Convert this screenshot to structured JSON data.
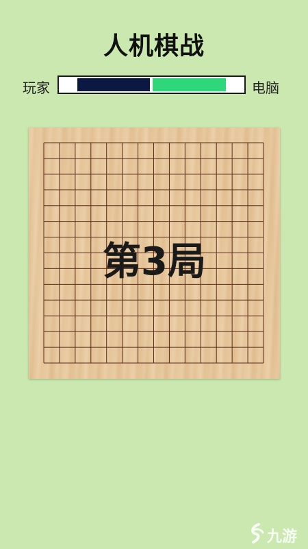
{
  "header": {
    "title": "人机棋战"
  },
  "score": {
    "player_label": "玩家",
    "ai_label": "电脑",
    "player_fraction": 0.49,
    "ai_fraction": 0.4,
    "player_color": "#0b1842",
    "ai_color": "#2ed87a"
  },
  "board": {
    "lines": 15,
    "line_color": "#5a2a1a",
    "wood_color": "#e8c79a"
  },
  "overlay": {
    "round_text": "第3局"
  },
  "watermark": {
    "text": "九游",
    "icon": "jiuyou-logo-icon"
  }
}
